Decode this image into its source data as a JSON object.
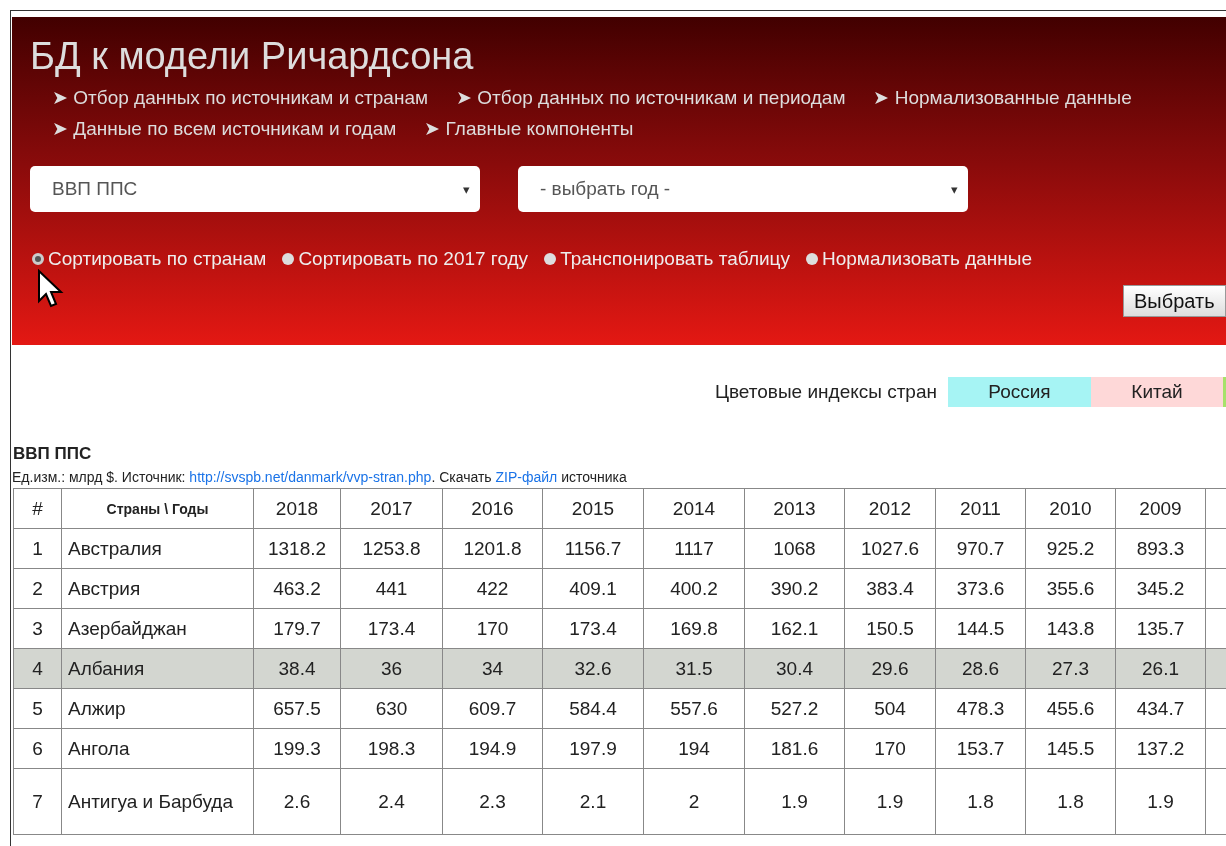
{
  "header": {
    "title": "БД к модели Ричардсона",
    "nav": [
      {
        "arrow": "➤",
        "label": "Отбор данных по источникам и странам"
      },
      {
        "arrow": "➤",
        "label": "Отбор данных по источникам и периодам"
      },
      {
        "arrow": "➤",
        "label": "Нормализованные данные"
      },
      {
        "arrow": "➤",
        "label": "Данные по всем источникам и годам"
      },
      {
        "arrow": "➤",
        "label": "Главные компоненты"
      }
    ],
    "selects": [
      {
        "value": "ВВП ППС",
        "caret": "▾"
      },
      {
        "value": "- выбрать год -",
        "caret": "▾"
      }
    ],
    "options": [
      {
        "label": "Сортировать по странам",
        "selected": true
      },
      {
        "label": "Сортировать по 2017 году",
        "selected": false
      },
      {
        "label": "Транспонировать таблицу",
        "selected": false
      },
      {
        "label": "Нормализовать данные",
        "selected": false
      }
    ],
    "button": "Выбрать"
  },
  "legend": {
    "label": "Цветовые индексы стран",
    "items": [
      {
        "label": "Россия",
        "color": "#a6f4f4"
      },
      {
        "label": "Китай",
        "color": "#fed8d8"
      },
      {
        "color": "#a6e26a"
      }
    ]
  },
  "table": {
    "title": "ВВП ППС",
    "source": "Ед.изм.: млрд $. Источник: ",
    "link": "http://svspb.net/danmark/vvp-stran.php",
    "mid": ". Скачать ",
    "zip": "ZIP-файл",
    "tail": " источника",
    "columns": [
      "#",
      "Страны \\ Годы",
      "2018",
      "2017",
      "2016",
      "2015",
      "2014",
      "2013",
      "2012",
      "2011",
      "2010",
      "2009"
    ],
    "rows": [
      {
        "selected": false,
        "cells": [
          "1",
          "Австралия",
          "1318.2",
          "1253.8",
          "1201.8",
          "1156.7",
          "1117",
          "1068",
          "1027.6",
          "970.7",
          "925.2",
          "893.3"
        ]
      },
      {
        "selected": false,
        "cells": [
          "2",
          "Австрия",
          "463.2",
          "441",
          "422",
          "409.1",
          "400.2",
          "390.2",
          "383.4",
          "373.6",
          "355.6",
          "345.2"
        ]
      },
      {
        "selected": false,
        "cells": [
          "3",
          "Азербайджан",
          "179.7",
          "173.4",
          "170",
          "173.4",
          "169.8",
          "162.1",
          "150.5",
          "144.5",
          "143.8",
          "135.7"
        ]
      },
      {
        "selected": true,
        "cells": [
          "4",
          "Албания",
          "38.4",
          "36",
          "34",
          "32.6",
          "31.5",
          "30.4",
          "29.6",
          "28.6",
          "27.3",
          "26.1"
        ]
      },
      {
        "selected": false,
        "cells": [
          "5",
          "Алжир",
          "657.5",
          "630",
          "609.7",
          "584.4",
          "557.6",
          "527.2",
          "504",
          "478.3",
          "455.6",
          "434.7"
        ]
      },
      {
        "selected": false,
        "cells": [
          "6",
          "Ангола",
          "199.3",
          "198.3",
          "194.9",
          "197.9",
          "194",
          "181.6",
          "170",
          "153.7",
          "145.5",
          "137.2"
        ]
      },
      {
        "selected": false,
        "cells": [
          "7",
          "Антигуа и Барбуда",
          "2.6",
          "2.4",
          "2.3",
          "2.1",
          "2",
          "1.9",
          "1.9",
          "1.8",
          "1.8",
          "1.9"
        ]
      }
    ]
  }
}
